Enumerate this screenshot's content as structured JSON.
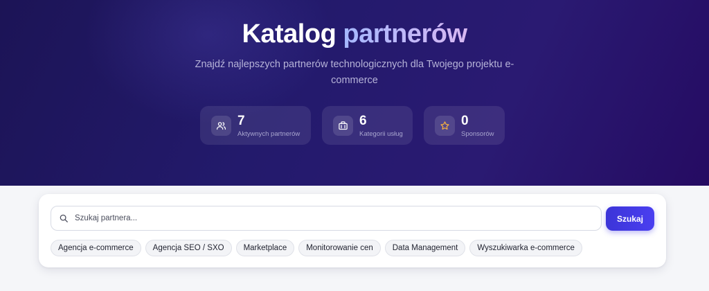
{
  "hero": {
    "title_main": "Katalog",
    "title_accent": "partnerów",
    "subtitle": "Znajdź najlepszych partnerów technologicznych dla Twojego projektu e-commerce"
  },
  "stats": [
    {
      "value": "7",
      "label": "Aktywnych partnerów",
      "icon": "users-icon"
    },
    {
      "value": "6",
      "label": "Kategorii usług",
      "icon": "briefcase-icon"
    },
    {
      "value": "0",
      "label": "Sponsorów",
      "icon": "star-icon"
    }
  ],
  "search": {
    "placeholder": "Szukaj partnera...",
    "value": "",
    "button_label": "Szukaj"
  },
  "categories": [
    "Agencja e-commerce",
    "Agencja SEO / SXO",
    "Marketplace",
    "Monitorowanie cen",
    "Data Management",
    "Wyszukiwarka e-commerce"
  ],
  "colors": {
    "hero_start": "#1c1456",
    "hero_end": "#250b62",
    "accent_button": "#4338e6",
    "star": "#f5b041"
  }
}
